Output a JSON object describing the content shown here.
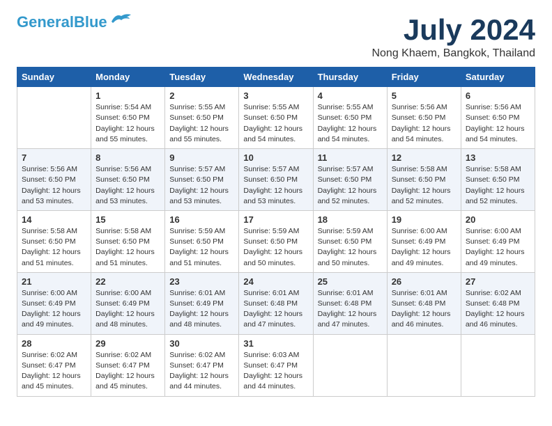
{
  "header": {
    "logo_line1": "General",
    "logo_line2": "Blue",
    "month": "July 2024",
    "location": "Nong Khaem, Bangkok, Thailand"
  },
  "weekdays": [
    "Sunday",
    "Monday",
    "Tuesday",
    "Wednesday",
    "Thursday",
    "Friday",
    "Saturday"
  ],
  "weeks": [
    [
      {
        "day": "",
        "sunrise": "",
        "sunset": "",
        "daylight": ""
      },
      {
        "day": "1",
        "sunrise": "Sunrise: 5:54 AM",
        "sunset": "Sunset: 6:50 PM",
        "daylight": "Daylight: 12 hours and 55 minutes."
      },
      {
        "day": "2",
        "sunrise": "Sunrise: 5:55 AM",
        "sunset": "Sunset: 6:50 PM",
        "daylight": "Daylight: 12 hours and 55 minutes."
      },
      {
        "day": "3",
        "sunrise": "Sunrise: 5:55 AM",
        "sunset": "Sunset: 6:50 PM",
        "daylight": "Daylight: 12 hours and 54 minutes."
      },
      {
        "day": "4",
        "sunrise": "Sunrise: 5:55 AM",
        "sunset": "Sunset: 6:50 PM",
        "daylight": "Daylight: 12 hours and 54 minutes."
      },
      {
        "day": "5",
        "sunrise": "Sunrise: 5:56 AM",
        "sunset": "Sunset: 6:50 PM",
        "daylight": "Daylight: 12 hours and 54 minutes."
      },
      {
        "day": "6",
        "sunrise": "Sunrise: 5:56 AM",
        "sunset": "Sunset: 6:50 PM",
        "daylight": "Daylight: 12 hours and 54 minutes."
      }
    ],
    [
      {
        "day": "7",
        "sunrise": "Sunrise: 5:56 AM",
        "sunset": "Sunset: 6:50 PM",
        "daylight": "Daylight: 12 hours and 53 minutes."
      },
      {
        "day": "8",
        "sunrise": "Sunrise: 5:56 AM",
        "sunset": "Sunset: 6:50 PM",
        "daylight": "Daylight: 12 hours and 53 minutes."
      },
      {
        "day": "9",
        "sunrise": "Sunrise: 5:57 AM",
        "sunset": "Sunset: 6:50 PM",
        "daylight": "Daylight: 12 hours and 53 minutes."
      },
      {
        "day": "10",
        "sunrise": "Sunrise: 5:57 AM",
        "sunset": "Sunset: 6:50 PM",
        "daylight": "Daylight: 12 hours and 53 minutes."
      },
      {
        "day": "11",
        "sunrise": "Sunrise: 5:57 AM",
        "sunset": "Sunset: 6:50 PM",
        "daylight": "Daylight: 12 hours and 52 minutes."
      },
      {
        "day": "12",
        "sunrise": "Sunrise: 5:58 AM",
        "sunset": "Sunset: 6:50 PM",
        "daylight": "Daylight: 12 hours and 52 minutes."
      },
      {
        "day": "13",
        "sunrise": "Sunrise: 5:58 AM",
        "sunset": "Sunset: 6:50 PM",
        "daylight": "Daylight: 12 hours and 52 minutes."
      }
    ],
    [
      {
        "day": "14",
        "sunrise": "Sunrise: 5:58 AM",
        "sunset": "Sunset: 6:50 PM",
        "daylight": "Daylight: 12 hours and 51 minutes."
      },
      {
        "day": "15",
        "sunrise": "Sunrise: 5:58 AM",
        "sunset": "Sunset: 6:50 PM",
        "daylight": "Daylight: 12 hours and 51 minutes."
      },
      {
        "day": "16",
        "sunrise": "Sunrise: 5:59 AM",
        "sunset": "Sunset: 6:50 PM",
        "daylight": "Daylight: 12 hours and 51 minutes."
      },
      {
        "day": "17",
        "sunrise": "Sunrise: 5:59 AM",
        "sunset": "Sunset: 6:50 PM",
        "daylight": "Daylight: 12 hours and 50 minutes."
      },
      {
        "day": "18",
        "sunrise": "Sunrise: 5:59 AM",
        "sunset": "Sunset: 6:50 PM",
        "daylight": "Daylight: 12 hours and 50 minutes."
      },
      {
        "day": "19",
        "sunrise": "Sunrise: 6:00 AM",
        "sunset": "Sunset: 6:49 PM",
        "daylight": "Daylight: 12 hours and 49 minutes."
      },
      {
        "day": "20",
        "sunrise": "Sunrise: 6:00 AM",
        "sunset": "Sunset: 6:49 PM",
        "daylight": "Daylight: 12 hours and 49 minutes."
      }
    ],
    [
      {
        "day": "21",
        "sunrise": "Sunrise: 6:00 AM",
        "sunset": "Sunset: 6:49 PM",
        "daylight": "Daylight: 12 hours and 49 minutes."
      },
      {
        "day": "22",
        "sunrise": "Sunrise: 6:00 AM",
        "sunset": "Sunset: 6:49 PM",
        "daylight": "Daylight: 12 hours and 48 minutes."
      },
      {
        "day": "23",
        "sunrise": "Sunrise: 6:01 AM",
        "sunset": "Sunset: 6:49 PM",
        "daylight": "Daylight: 12 hours and 48 minutes."
      },
      {
        "day": "24",
        "sunrise": "Sunrise: 6:01 AM",
        "sunset": "Sunset: 6:48 PM",
        "daylight": "Daylight: 12 hours and 47 minutes."
      },
      {
        "day": "25",
        "sunrise": "Sunrise: 6:01 AM",
        "sunset": "Sunset: 6:48 PM",
        "daylight": "Daylight: 12 hours and 47 minutes."
      },
      {
        "day": "26",
        "sunrise": "Sunrise: 6:01 AM",
        "sunset": "Sunset: 6:48 PM",
        "daylight": "Daylight: 12 hours and 46 minutes."
      },
      {
        "day": "27",
        "sunrise": "Sunrise: 6:02 AM",
        "sunset": "Sunset: 6:48 PM",
        "daylight": "Daylight: 12 hours and 46 minutes."
      }
    ],
    [
      {
        "day": "28",
        "sunrise": "Sunrise: 6:02 AM",
        "sunset": "Sunset: 6:47 PM",
        "daylight": "Daylight: 12 hours and 45 minutes."
      },
      {
        "day": "29",
        "sunrise": "Sunrise: 6:02 AM",
        "sunset": "Sunset: 6:47 PM",
        "daylight": "Daylight: 12 hours and 45 minutes."
      },
      {
        "day": "30",
        "sunrise": "Sunrise: 6:02 AM",
        "sunset": "Sunset: 6:47 PM",
        "daylight": "Daylight: 12 hours and 44 minutes."
      },
      {
        "day": "31",
        "sunrise": "Sunrise: 6:03 AM",
        "sunset": "Sunset: 6:47 PM",
        "daylight": "Daylight: 12 hours and 44 minutes."
      },
      {
        "day": "",
        "sunrise": "",
        "sunset": "",
        "daylight": ""
      },
      {
        "day": "",
        "sunrise": "",
        "sunset": "",
        "daylight": ""
      },
      {
        "day": "",
        "sunrise": "",
        "sunset": "",
        "daylight": ""
      }
    ]
  ]
}
